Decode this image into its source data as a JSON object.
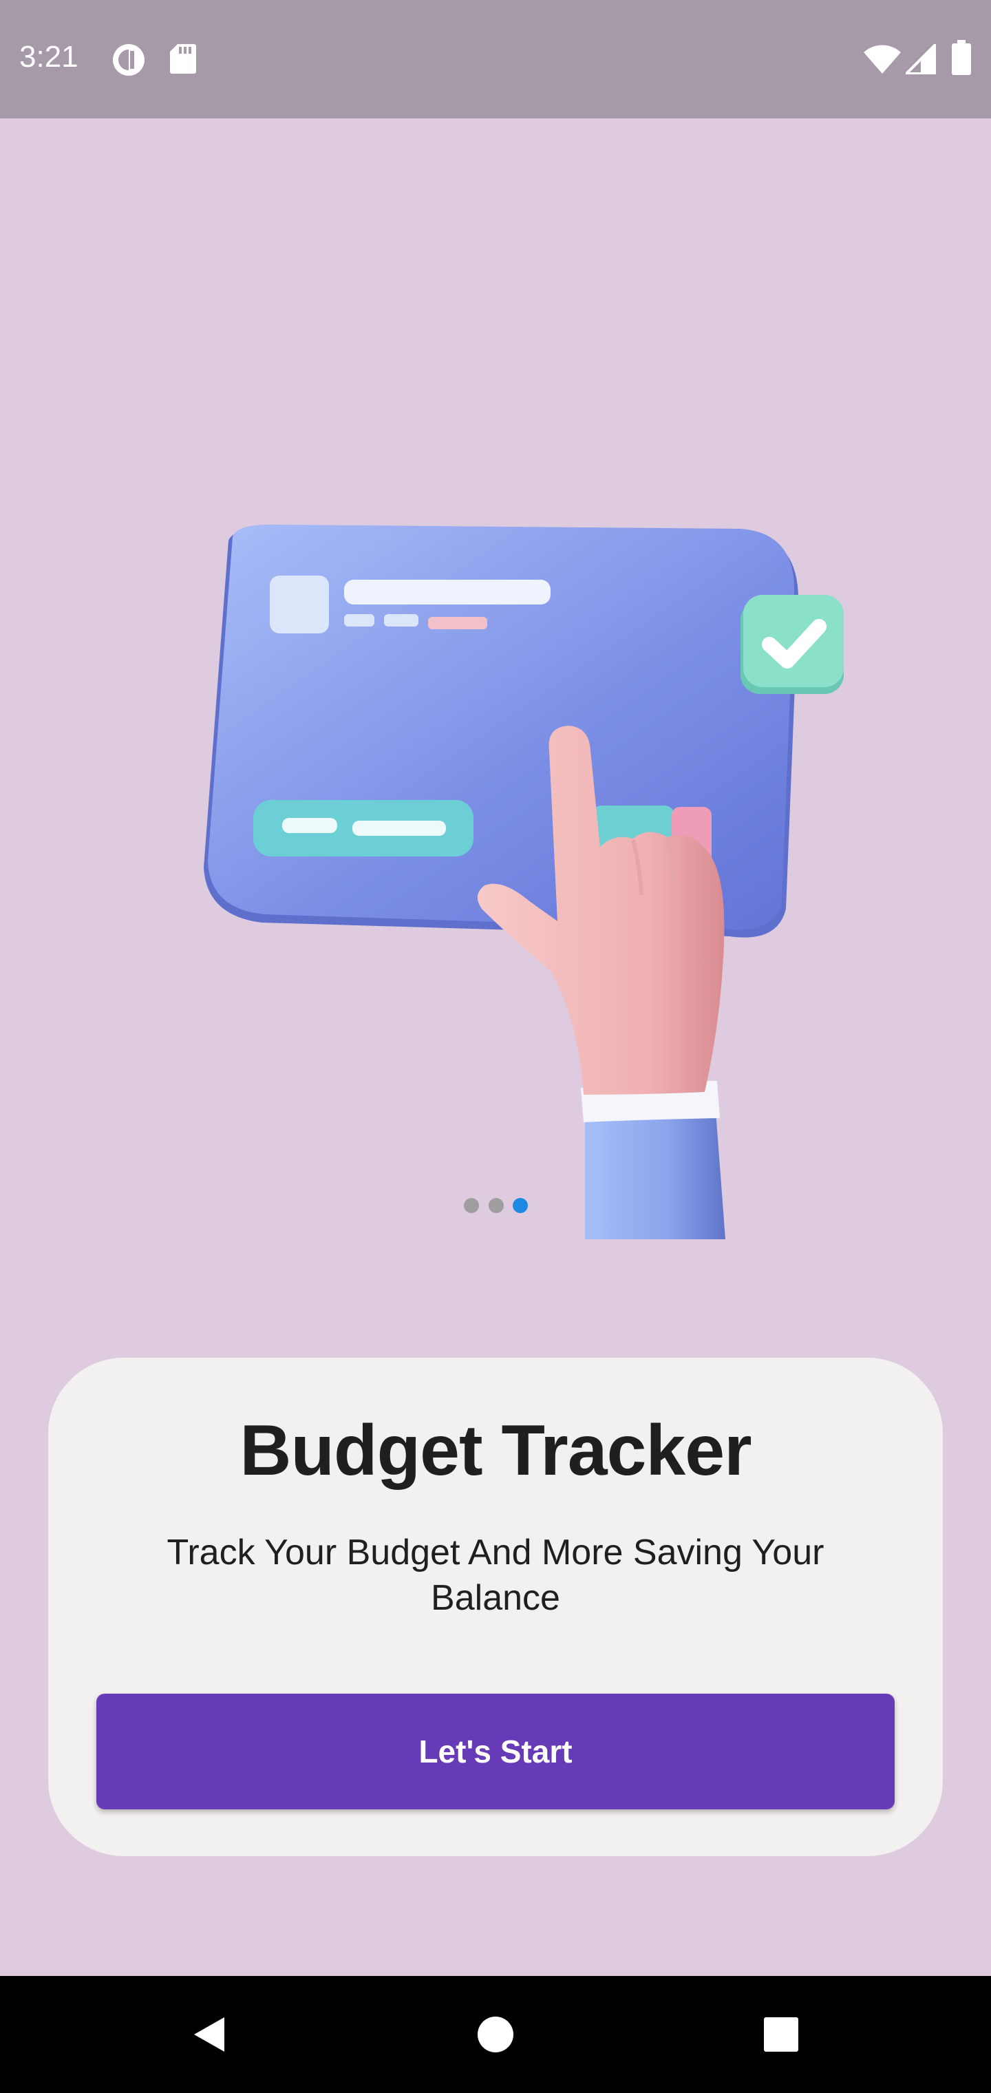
{
  "status_bar": {
    "time": "3:21",
    "icons": [
      "data-saver-icon",
      "sd-card-icon",
      "wifi-icon",
      "signal-icon",
      "battery-icon"
    ]
  },
  "onboarding": {
    "illustration": "credit-card-hand-illustration",
    "page_indicator": {
      "total": 3,
      "active_index": 2,
      "active_color": "#1e88e5",
      "inactive_color": "#9e9e9e"
    }
  },
  "card": {
    "title": "Budget Tracker",
    "subtitle": "Track Your Budget And More Saving Your Balance",
    "button_label": "Let's Start"
  },
  "nav_bar": {
    "buttons": [
      "back-icon",
      "home-icon",
      "recents-icon"
    ]
  },
  "colors": {
    "background": "#decbe0",
    "status_bar": "#a699a8",
    "card": "#f3f0f0",
    "accent": "#673ab7"
  }
}
